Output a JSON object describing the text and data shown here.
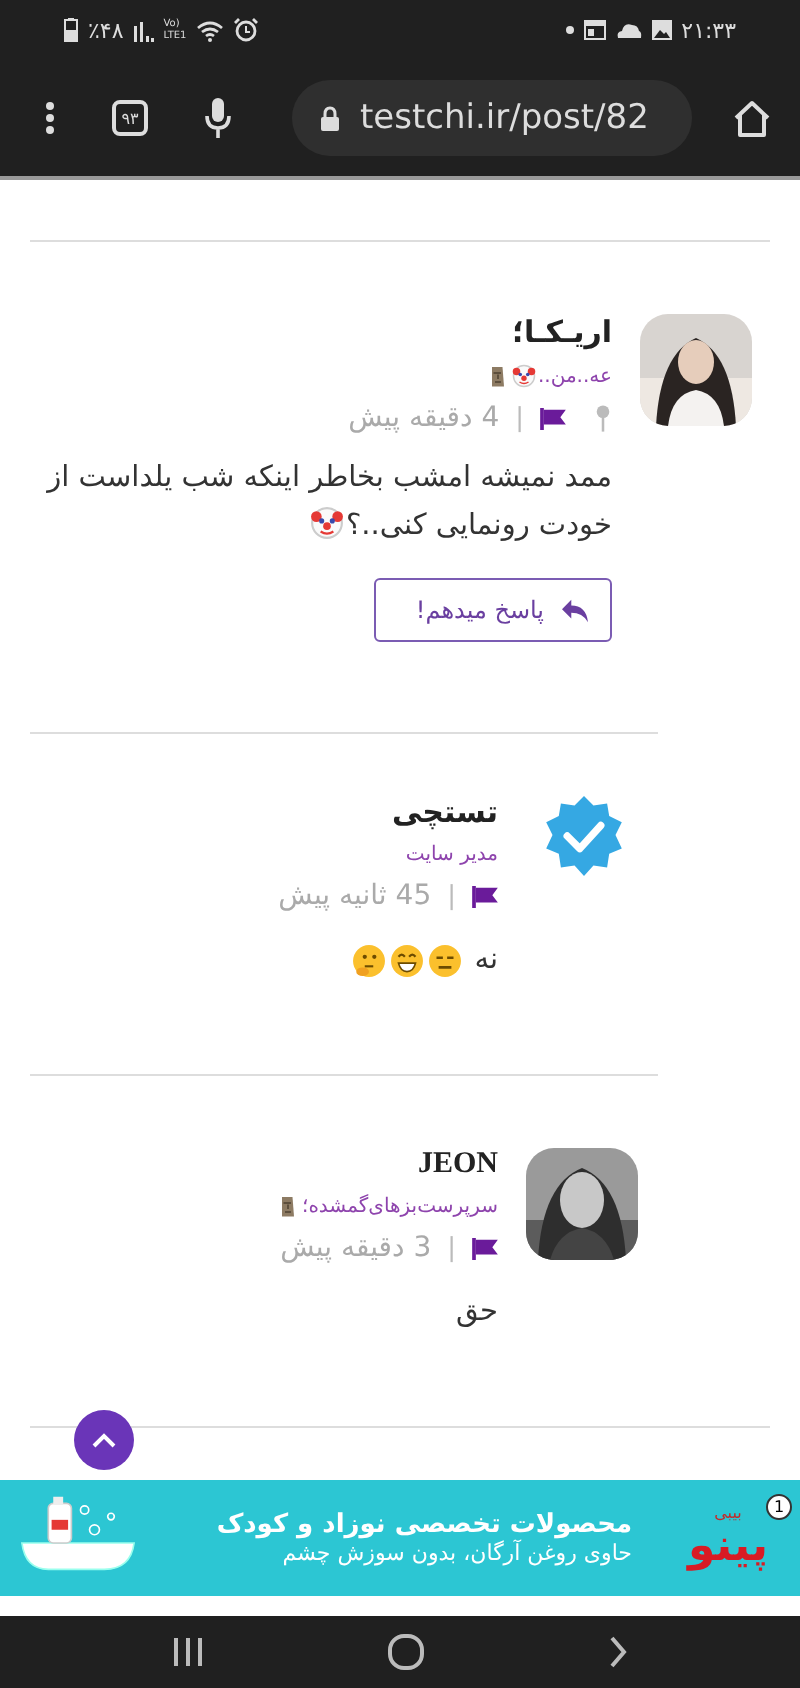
{
  "status_bar": {
    "battery": "٪۴۸",
    "volte_top": "Vo)",
    "volte_bottom": "LTE1",
    "time": "۲۱:۳۳"
  },
  "browser": {
    "tab_count": "۹۳",
    "url": "testchi.ir/post/82"
  },
  "comments": [
    {
      "name": "اریـکـا؛",
      "role": "عه..من..",
      "role_icons": [
        {
          "kind": "clown"
        },
        {
          "kind": "moai"
        }
      ],
      "avatar": {
        "kind": "picture"
      },
      "pinned": true,
      "separator": "|",
      "time": "4 دقیقه پیش",
      "text": "ممد نمیشه امشب بخاطر اینکه شب یلداست از خودت رونمایی کنی..؟",
      "text_icons": [
        {
          "kind": "clown"
        }
      ],
      "reply_button": "پاسخ میدهم!",
      "children": [
        {
          "name": "تستچی",
          "role": "مدیر سایت",
          "avatar": {
            "kind": "verified"
          },
          "pinned": false,
          "separator": "|",
          "time": "45 ثانیه پیش",
          "text": "نه",
          "text_icons": [
            {
              "kind": "neutral"
            },
            {
              "kind": "grin"
            },
            {
              "kind": "thinking"
            }
          ]
        },
        {
          "name": "JEON",
          "role": "سرپرست‌بزهای‌گمشده؛",
          "role_icons": [
            {
              "kind": "moai"
            }
          ],
          "avatar": {
            "kind": "picture"
          },
          "pinned": false,
          "separator": "|",
          "time": "3 دقیقه پیش",
          "text": "حق"
        }
      ]
    }
  ],
  "ad": {
    "badge": "1",
    "brand": "پینو",
    "brand_top": "بیبی",
    "headline": "محصولات تخصصی نوزاد و کودک",
    "subline": "حاوی روغن آرگان، بدون سوزش چشم"
  }
}
